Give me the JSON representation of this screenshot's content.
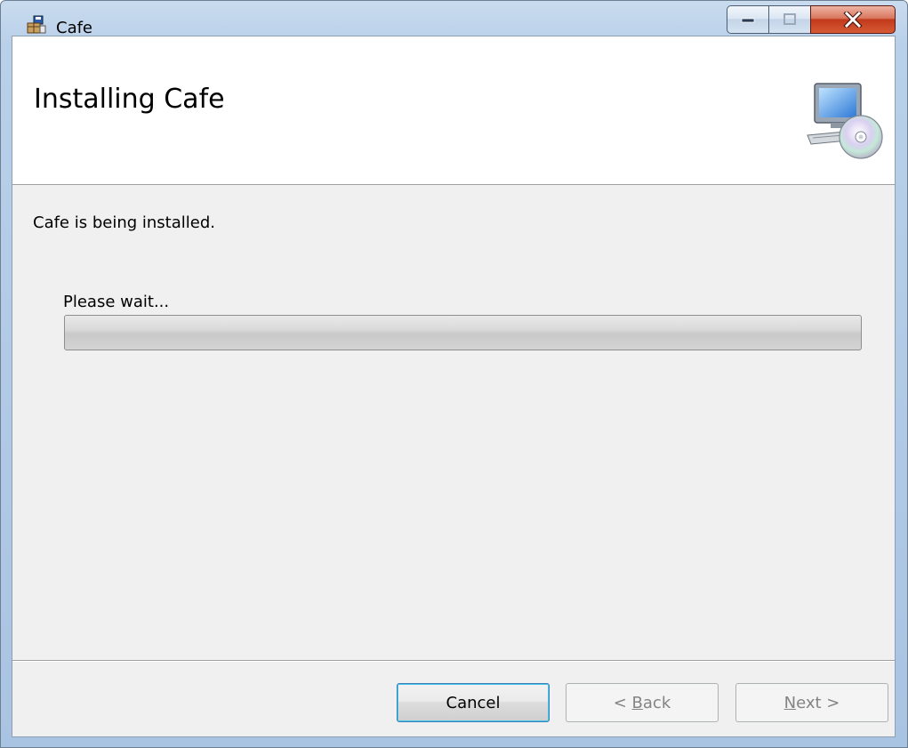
{
  "window": {
    "title": "Cafe",
    "icons": {
      "app": "installer-package-icon",
      "minimize": "minimize-icon",
      "maximize": "maximize-icon",
      "close": "close-icon"
    },
    "colors": {
      "close_button": "#c2391b",
      "title_bar": "#b9d0ea"
    }
  },
  "header": {
    "title": "Installing Cafe",
    "graphic": "computer-with-disc-icon"
  },
  "body": {
    "status": "Cafe is being installed.",
    "wait_label": "Please wait...",
    "progress": 0
  },
  "buttons": {
    "cancel": "Cancel",
    "back_prefix": "< ",
    "back_mnemonic": "B",
    "back_rest": "ack",
    "next_mnemonic": "N",
    "next_rest": "ext >"
  }
}
